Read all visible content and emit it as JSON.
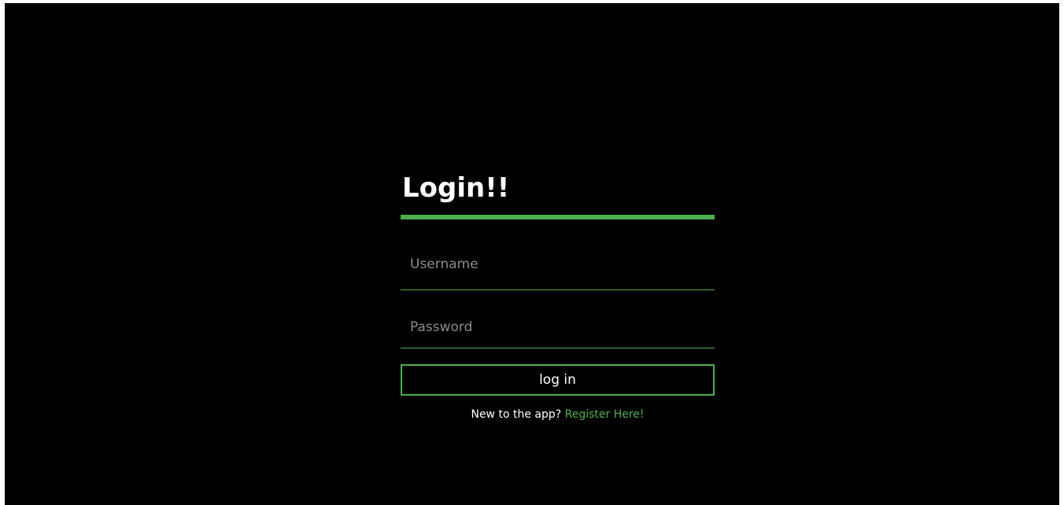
{
  "colors": {
    "background": "#000000",
    "accent": "#4caf50",
    "text": "#ffffff",
    "placeholder": "#8a8a8a"
  },
  "login": {
    "title": "Login!!",
    "username_placeholder": "Username",
    "username_value": "",
    "password_placeholder": "Password",
    "password_value": "",
    "submit_label": "log in",
    "register_prompt": "New to the app?",
    "register_link": "Register Here!"
  }
}
